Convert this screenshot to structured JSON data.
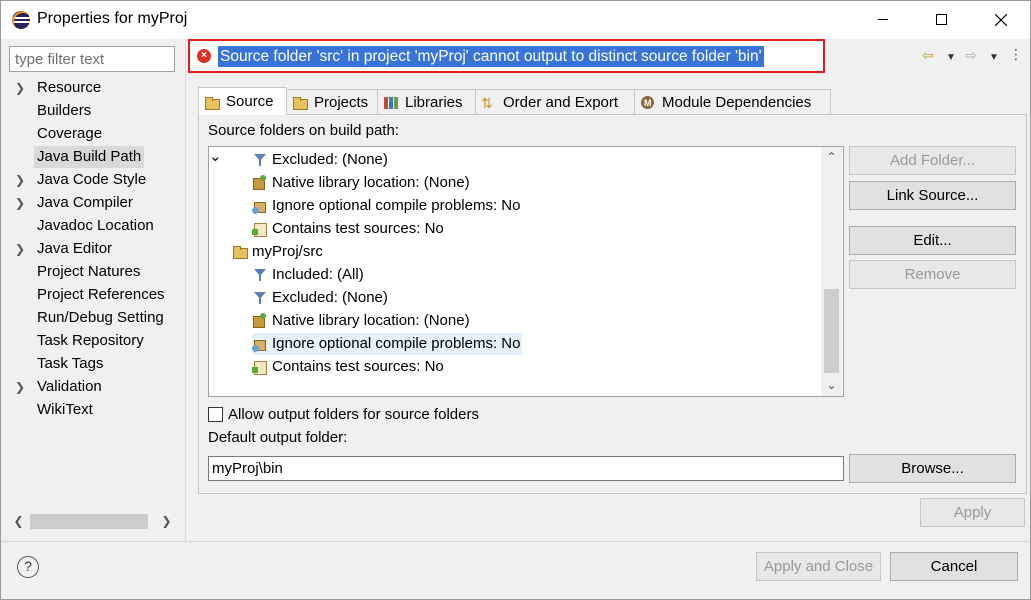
{
  "window": {
    "title": "Properties for myProj"
  },
  "left": {
    "filter_placeholder": "type filter text",
    "nav": [
      {
        "label": "Resource",
        "expandable": true
      },
      {
        "label": "Builders",
        "expandable": false
      },
      {
        "label": "Coverage",
        "expandable": false
      },
      {
        "label": "Java Build Path",
        "expandable": false,
        "selected": true
      },
      {
        "label": "Java Code Style",
        "expandable": true
      },
      {
        "label": "Java Compiler",
        "expandable": true
      },
      {
        "label": "Javadoc Location",
        "expandable": false
      },
      {
        "label": "Java Editor",
        "expandable": true
      },
      {
        "label": "Project Natures",
        "expandable": false
      },
      {
        "label": "Project References",
        "expandable": false
      },
      {
        "label": "Run/Debug Setting",
        "expandable": false
      },
      {
        "label": "Task Repository",
        "expandable": false
      },
      {
        "label": "Task Tags",
        "expandable": false
      },
      {
        "label": "Validation",
        "expandable": true
      },
      {
        "label": "WikiText",
        "expandable": false
      }
    ]
  },
  "header": {
    "error_message": "Source folder 'src' in project 'myProj' cannot output to distinct source folder 'bin'",
    "error_color": "#e31c1c"
  },
  "tabs": [
    {
      "label": "Source",
      "icon": "source-folder-icon",
      "active": true
    },
    {
      "label": "Projects",
      "icon": "projects-icon"
    },
    {
      "label": "Libraries",
      "icon": "libraries-icon"
    },
    {
      "label": "Order and Export",
      "icon": "order-export-icon"
    },
    {
      "label": "Module Dependencies",
      "icon": "module-icon"
    }
  ],
  "source": {
    "label": "Source folders on build path:",
    "tree": [
      {
        "label": "Excluded: (None)",
        "icon": "filter-icon",
        "level": 1
      },
      {
        "label": "Native library location: (None)",
        "icon": "native-library-icon",
        "level": 1
      },
      {
        "label": "Ignore optional compile problems: No",
        "icon": "ignore-problems-icon",
        "level": 1
      },
      {
        "label": "Contains test sources: No",
        "icon": "test-sources-icon",
        "level": 1
      },
      {
        "label": "myProj/src",
        "icon": "source-folder-icon",
        "level": 0,
        "expanded": true
      },
      {
        "label": "Included: (All)",
        "icon": "filter-icon",
        "level": 1
      },
      {
        "label": "Excluded: (None)",
        "icon": "filter-icon",
        "level": 1
      },
      {
        "label": "Native library location: (None)",
        "icon": "native-library-icon",
        "level": 1
      },
      {
        "label": "Ignore optional compile problems: No",
        "icon": "ignore-problems-icon",
        "level": 1,
        "selected": true
      },
      {
        "label": "Contains test sources: No",
        "icon": "test-sources-icon",
        "level": 1
      }
    ],
    "buttons": {
      "add_folder": "Add Folder...",
      "link_source": "Link Source...",
      "edit": "Edit...",
      "remove": "Remove"
    },
    "allow_output_label": "Allow output folders for source folders",
    "allow_output_checked": false,
    "default_output_label": "Default output folder:",
    "default_output_value": "myProj\\bin",
    "browse": "Browse..."
  },
  "footer": {
    "apply": "Apply",
    "apply_and_close": "Apply and Close",
    "cancel": "Cancel"
  }
}
